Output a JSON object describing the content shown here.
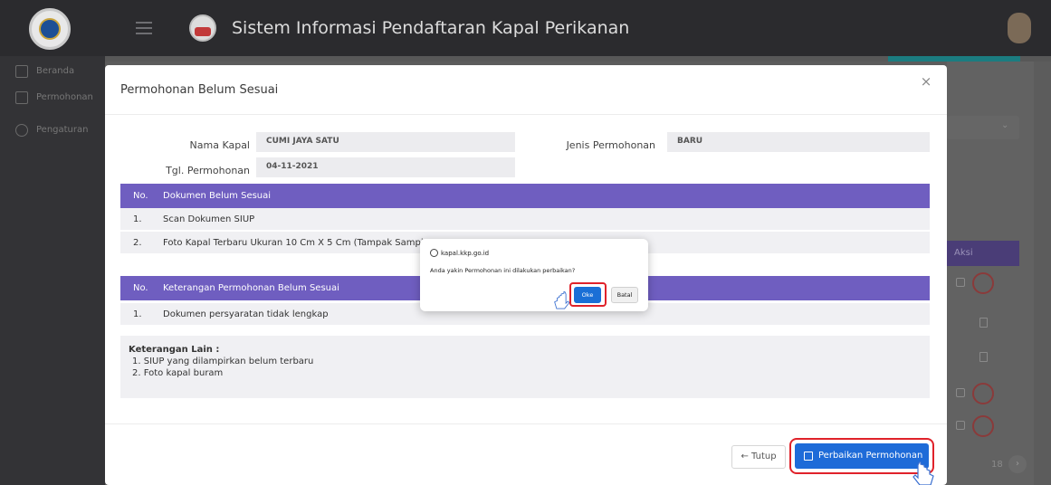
{
  "app": {
    "title": "Sistem Informasi Pendaftaran Kapal Perikanan"
  },
  "sidebar": {
    "items": [
      {
        "label": "Beranda",
        "icon": "monitor-icon"
      },
      {
        "label": "Permohonan",
        "icon": "document-icon"
      },
      {
        "label": "Pengaturan",
        "icon": "gear-icon"
      }
    ]
  },
  "background": {
    "aksi_header": "Aksi",
    "pager_page": "18",
    "pager_next": "›",
    "select_chevron": "⌄"
  },
  "modal": {
    "title": "Permohonan Belum Sesuai",
    "close": "×",
    "fields": {
      "nama_kapal_label": "Nama Kapal",
      "nama_kapal_value": "CUMI JAYA SATU",
      "tgl_label": "Tgl. Permohonan",
      "tgl_value": "04-11-2021",
      "jenis_label": "Jenis Permohonan",
      "jenis_value": "BARU"
    },
    "dokumen_table": {
      "header_no": "No.",
      "header_text": "Dokumen Belum Sesuai",
      "rows": [
        {
          "no": "1.",
          "text": "Scan Dokumen SIUP"
        },
        {
          "no": "2.",
          "text": "Foto Kapal Terbaru Ukuran 10 Cm X 5 Cm (Tampak Samping"
        }
      ]
    },
    "keterangan_table": {
      "header_no": "No.",
      "header_text": "Keterangan Permohonan Belum Sesuai",
      "rows": [
        {
          "no": "1.",
          "text": "Dokumen persyaratan tidak lengkap"
        }
      ]
    },
    "keterangan_lain": {
      "heading": "Keterangan Lain :",
      "lines": [
        "1. SIUP yang dilampirkan belum terbaru",
        "2. Foto kapal buram"
      ]
    },
    "buttons": {
      "tutup": "← Tutup",
      "perbaikan": "Perbaikan Permohonan"
    }
  },
  "confirm_dialog": {
    "origin": "kapal.kkp.go.id",
    "message": "Anda yakin Permohonan ini dilakukan perbaikan?",
    "ok": "Oke",
    "cancel": "Batal"
  },
  "colors": {
    "accent_purple": "#6f5ec0",
    "primary_blue": "#1e6bd8",
    "highlight_red": "#e0222a",
    "teal": "#1b7c80"
  }
}
